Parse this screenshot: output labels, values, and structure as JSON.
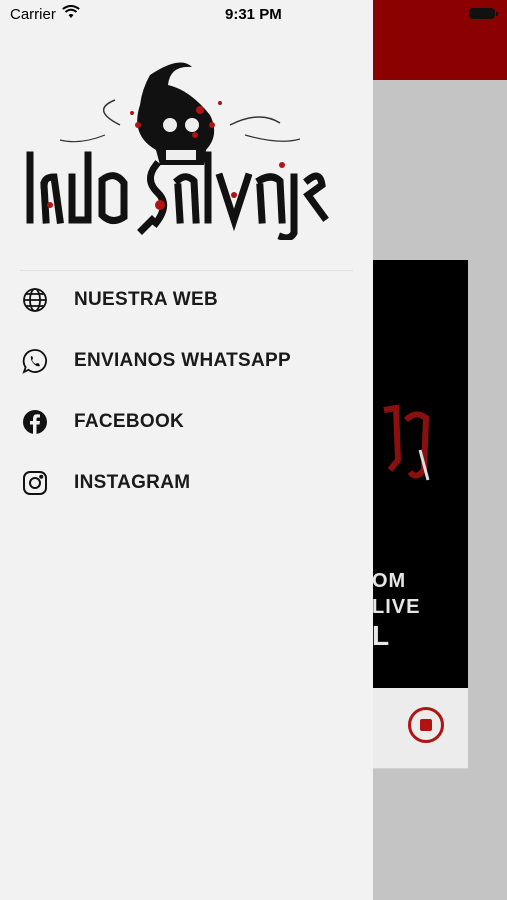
{
  "status_bar": {
    "carrier": "Carrier",
    "time": "9:31 PM"
  },
  "background_app": {
    "header_color": "#8b0000",
    "art_text_lines": [
      "OM",
      "LIVE",
      "L"
    ]
  },
  "drawer": {
    "brand_alt": "lado salvaje",
    "menu": [
      {
        "label": "NUESTRA WEB",
        "icon": "globe-icon"
      },
      {
        "label": "ENVIANOS WHATSAPP",
        "icon": "whatsapp-icon"
      },
      {
        "label": "FACEBOOK",
        "icon": "facebook-icon"
      },
      {
        "label": "INSTAGRAM",
        "icon": "instagram-icon"
      }
    ]
  },
  "colors": {
    "accent": "#b11212",
    "drawer_bg": "#f2f2f2",
    "text": "#1a1a1a"
  }
}
